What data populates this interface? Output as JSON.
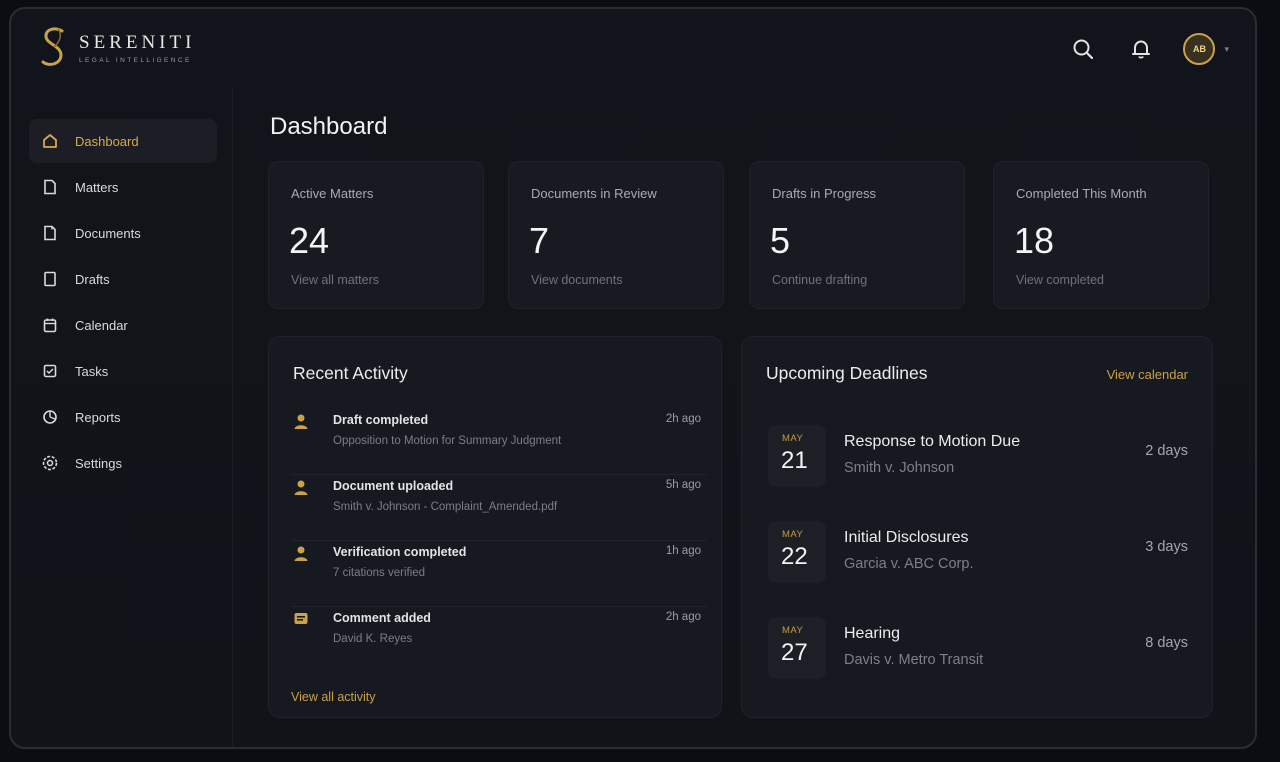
{
  "app": {
    "name": "SERENITI",
    "tagline": "LEGAL INTELLIGENCE"
  },
  "header": {
    "avatar_initials": "AB"
  },
  "sidebar": {
    "items": [
      {
        "label": "Dashboard",
        "icon": "home-icon",
        "active": true
      },
      {
        "label": "Matters",
        "icon": "file-icon"
      },
      {
        "label": "Documents",
        "icon": "document-icon"
      },
      {
        "label": "Drafts",
        "icon": "draft-icon"
      },
      {
        "label": "Calendar",
        "icon": "calendar-icon"
      },
      {
        "label": "Tasks",
        "icon": "tasks-icon"
      },
      {
        "label": "Reports",
        "icon": "reports-icon"
      },
      {
        "label": "Settings",
        "icon": "gear-icon"
      }
    ]
  },
  "main": {
    "title": "Dashboard",
    "stats": [
      {
        "label": "Active Matters",
        "value": "24",
        "link": "View all matters"
      },
      {
        "label": "Documents in Review",
        "value": "7",
        "link": "View documents"
      },
      {
        "label": "Drafts in Progress",
        "value": "5",
        "link": "Continue drafting"
      },
      {
        "label": "Completed This Month",
        "value": "18",
        "link": "View completed"
      }
    ]
  },
  "recent_activity": {
    "title": "Recent Activity",
    "items": [
      {
        "title": "Draft completed",
        "subtitle": "Opposition to Motion for Summary Judgment",
        "time": "2h ago"
      },
      {
        "title": "Document uploaded",
        "subtitle": "Smith v. Johnson - Complaint_Amended.pdf",
        "time": "5h ago"
      },
      {
        "title": "Verification completed",
        "subtitle": "7 citations verified",
        "time": "1h ago"
      },
      {
        "title": "Comment added",
        "subtitle": "David K. Reyes",
        "time": "2h ago"
      }
    ],
    "view_all": "View all activity"
  },
  "deadlines": {
    "title": "Upcoming Deadlines",
    "view_calendar": "View calendar",
    "items": [
      {
        "month": "MAY",
        "day": "21",
        "title": "Response to Motion Due",
        "case": "Smith v. Johnson",
        "due": "2 days"
      },
      {
        "month": "MAY",
        "day": "22",
        "title": "Initial Disclosures",
        "case": "Garcia v. ABC Corp.",
        "due": "3 days"
      },
      {
        "month": "MAY",
        "day": "27",
        "title": "Hearing",
        "case": "Davis v. Metro Transit",
        "due": "8 days"
      }
    ]
  },
  "colors": {
    "accent_gold": "#c9a24a",
    "background": "#12141b",
    "card": "#181a22"
  }
}
